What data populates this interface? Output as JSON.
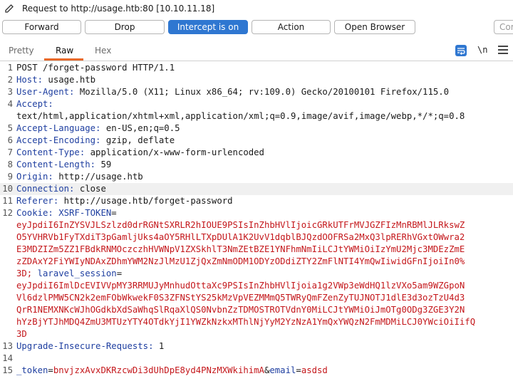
{
  "window": {
    "title": "Request to http://usage.htb:80  [10.10.11.18]"
  },
  "toolbar": {
    "forward": "Forward",
    "drop": "Drop",
    "intercept": "Intercept is on",
    "action": "Action",
    "open_browser": "Open Browser",
    "comment_placeholder": "Cor"
  },
  "tabs": {
    "pretty": "Pretty",
    "raw": "Raw",
    "hex": "Hex"
  },
  "icons": {
    "newline": "\\n"
  },
  "request": {
    "ln": [
      "1",
      "2",
      "3",
      "4",
      "",
      "5",
      "6",
      "7",
      "8",
      "9",
      "10",
      "11",
      "12",
      "",
      "",
      "",
      "",
      "",
      "",
      "",
      "",
      "",
      "",
      "13",
      "14",
      "15"
    ],
    "l1": "POST /forget-password HTTP/1.1",
    "host_k": "Host:",
    "host_v": " usage.htb",
    "ua_k": "User-Agent:",
    "ua_v": " Mozilla/5.0 (X11; Linux x86_64; rv:109.0) Gecko/20100101 Firefox/115.0",
    "accept_k": "Accept:",
    "accept_v": "text/html,application/xhtml+xml,application/xml;q=0.9,image/avif,image/webp,*/*;q=0.8",
    "al_k": "Accept-Language:",
    "al_v": " en-US,en;q=0.5",
    "ae_k": "Accept-Encoding:",
    "ae_v": " gzip, deflate",
    "ct_k": "Content-Type:",
    "ct_v": " application/x-www-form-urlencoded",
    "cl_k": "Content-Length:",
    "cl_v": " 59",
    "origin_k": "Origin:",
    "origin_v": " http://usage.htb",
    "conn_k": "Connection:",
    "conn_v": " close",
    "ref_k": "Referer:",
    "ref_v": " http://usage.htb/forget-password",
    "cookie_k": "Cookie:",
    "cookie_n1": " XSRF-TOKEN",
    "cookie_lines": [
      "eyJpdiI6InZYSVJLSzlzd0drRGNtSXRLR2hIOUE9PSIsInZhbHVlIjoicGRkUTFrMVJGZFIzMnRBMlJLRkswZ",
      "O5YVHRVb1FyTXdiT3pGamljUks4aOY5RHlLTXpDUlA1K2UvV1dqblBJQzdOOFRSa2MxQ3lpRERhVGxtOWwra2",
      "E3MDZIZm5ZZ1FBdkRNMOczczhHVWNpV1ZXSkhlT3NmZEtBZE1YNFhmNmIiLCJtYWMiOiIzYmU2Mjc3MDEzZmE",
      "zZDAxY2FiYWIyNDAxZDhmYWM2NzJlMzU1ZjQxZmNmODM1ODYzODdiZTY2ZmFlNTI4YmQwIiwidGFnIjoiIn0%"
    ],
    "cookie_mid_end": "3D;",
    "cookie_n2": " laravel_session",
    "session_lines": [
      "eyJpdiI6ImlDcEVIVVpMY3RRMUJyMnhudOttaXc9PSIsInZhbHVlIjoia1g2VWp3eWdHQ1lzVXo5am9WZGpoN",
      "Vl6dzlPMW5CN2k2emFObWkwekF0S3ZFNStYS25kMzVpVEZMMmQ5TWRyQmFZenZyTUJNOTJ1dlE3d3ozTzU4d3",
      "QrR1NEMXNKcWJhOGdkbXdSaWhqSlRqaXlQS0NvbnZzTDMOSTROTVdnY0MiLCJtYWMiOiJmOTg0ODg3ZGE3Y2N",
      "hYzBjYTJhMDQ4ZmU3MTUzYTY4OTdkYjI1YWZkNzkxMThlNjYyM2YzNzA1YmQxYWQzN2FmMDMiLCJ0YWciOiIifQ",
      "3D"
    ],
    "uir_k": "Upgrade-Insecure-Requests:",
    "uir_v": " 1",
    "body": {
      "p1_name": "_token",
      "eq1": "=",
      "p1_val": "bnvjzxAvxDKRzcwDi3dUhDpE8yd4PNzMXWkihimA",
      "amp": "&",
      "p2_name": "email",
      "eq2": "=",
      "p2_val": "asdsd"
    }
  },
  "colors": {
    "accent": "#2f77d1",
    "tab_underline": "#e8692a",
    "header_name": "#1f3fa0",
    "cookie_value": "#c4171b"
  }
}
